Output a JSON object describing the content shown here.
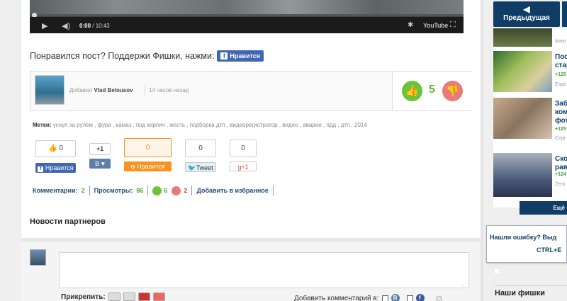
{
  "video": {
    "time_current": "0:00",
    "time_total": "/ 10:43",
    "youtube": "YouTube"
  },
  "like_prompt": {
    "text": "Понравился пост? Поддержи Фишки, нажми:",
    "fb_label": "Нравится"
  },
  "author": {
    "added_label": "Добавил",
    "name": "Vlad Belousov",
    "ago": "14 часов назад",
    "rating": "5"
  },
  "tags": {
    "label": "Метки:",
    "list": "уснул за рулем , фура , камаз , под кирпич , жесть , подборка дтп , видеорегистратор , видео , аварии , пдд , дтп , 2014"
  },
  "share": {
    "fb": {
      "count": "0",
      "label": "Нравится"
    },
    "vk": {
      "count": "+1",
      "label": "В"
    },
    "ok": {
      "count": "0",
      "label": "Нравится"
    },
    "tw": {
      "count": "0",
      "label": "Tweet"
    },
    "gp": {
      "count": "0",
      "label": "+1"
    }
  },
  "stats": {
    "comments_label": "Комментарии:",
    "comments": "2",
    "views_label": "Просмотры:",
    "views": "86",
    "likes": "6",
    "dislikes": "2",
    "favorite": "Добавить в избранное"
  },
  "partners_title": "Новости партнеров",
  "comment": {
    "attach_label": "Прикрепить:",
    "add_label": "Добавить комментарий в:"
  },
  "sidebar": {
    "prev_label": "Предыдущая",
    "items": [
      {
        "title": "",
        "count": "",
        "source": "Азер"
      },
      {
        "title": "Пос\nстар",
        "count": "+125",
        "source": "Espe"
      },
      {
        "title": "Заб\nком\nфот",
        "count": "+125",
        "source": "Серг"
      },
      {
        "title": "Ско\nрав",
        "count": "+124",
        "source": "Zero"
      }
    ],
    "more_label": "Ещё",
    "error_line1": "Нашли ошибку? Выд",
    "error_line2": "CTRL+E",
    "ours_title": "Наши фишки"
  },
  "colors": {
    "brand": "#0f3d66",
    "green": "#6bc33a",
    "red": "#e97a7a",
    "fb": "#4267b2",
    "ok": "#f7931e"
  }
}
